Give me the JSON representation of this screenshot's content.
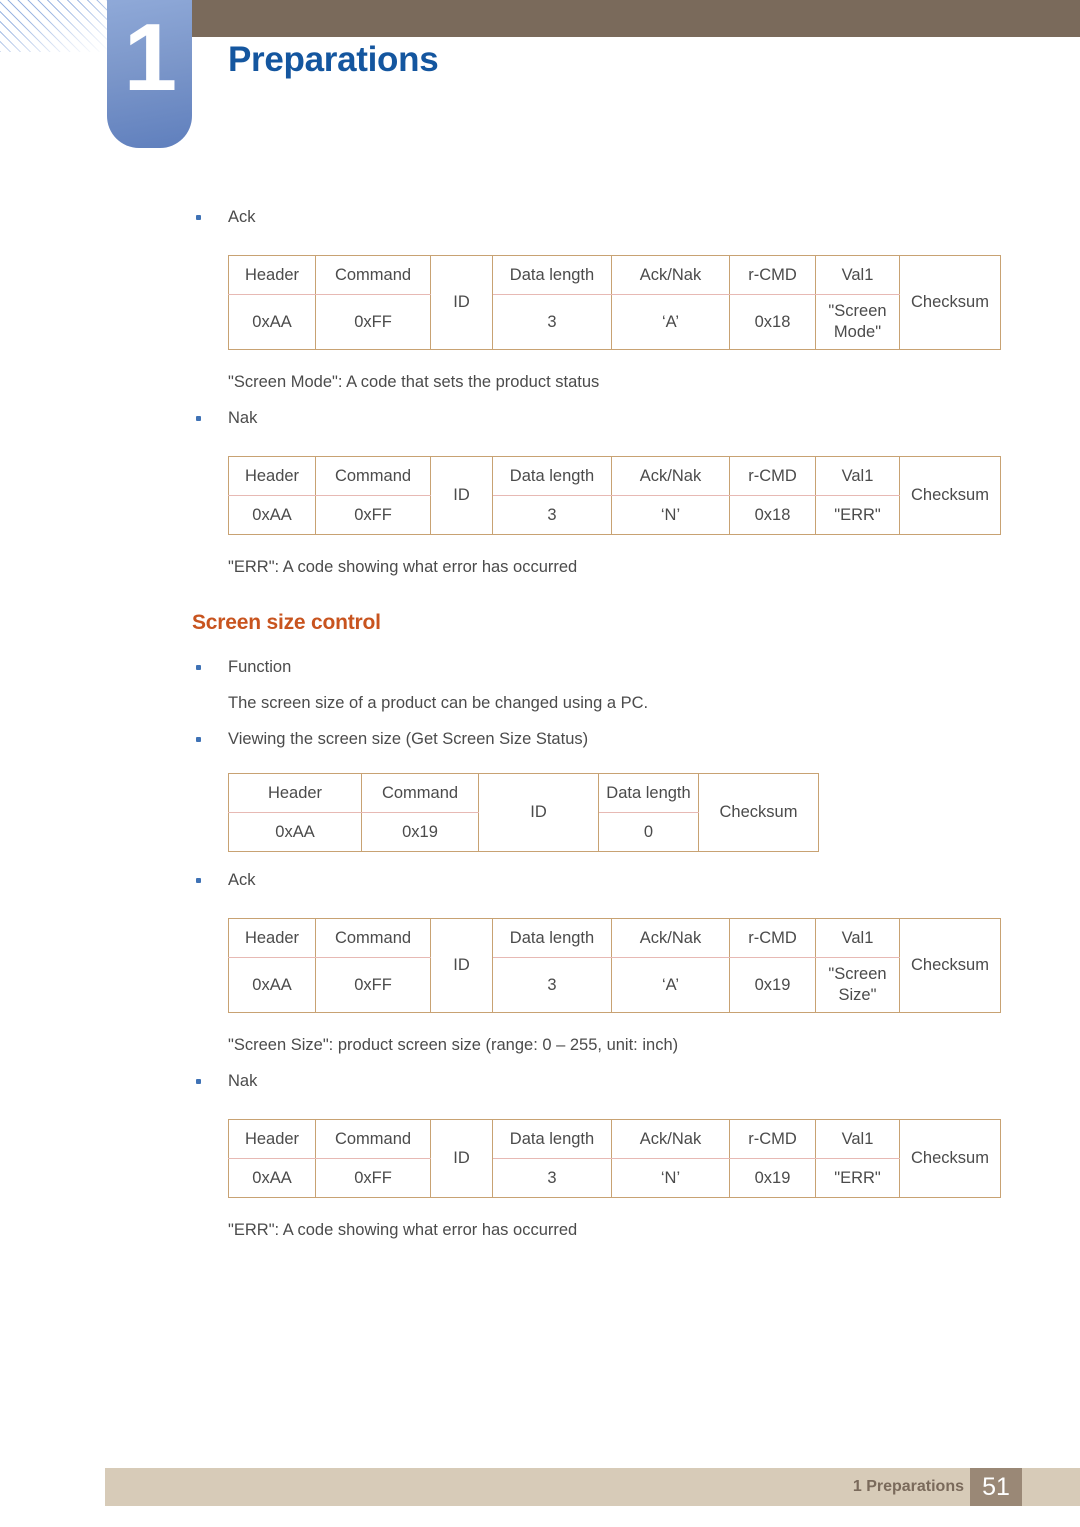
{
  "header": {
    "chapter_number": "1",
    "chapter_title": "Preparations",
    "bar_color": "#7a6a5b",
    "tab_color": "#7c97ca",
    "title_color": "#14569f"
  },
  "footer": {
    "label": "1 Preparations",
    "page_number": "51",
    "bar_color": "#d7cbb8",
    "page_box_color": "#9a8876"
  },
  "section": {
    "heading": "Screen size control",
    "heading_color": "#c8541f"
  },
  "labels": {
    "ack": "Ack",
    "nak": "Nak",
    "function": "Function",
    "viewing": "Viewing the screen size (Get Screen Size Status)"
  },
  "paragraphs": {
    "function_desc": "The screen size of a product can be changed using a PC.",
    "screen_mode_note": "\"Screen Mode\": A code that sets the product status",
    "err_note_1": "\"ERR\": A code showing what error has occurred",
    "screen_size_note": "\"Screen Size\": product screen size (range: 0 – 255, unit: inch)",
    "err_note_2": "\"ERR\": A code showing what error has occurred"
  },
  "tables": {
    "ack_screen_mode": {
      "headers": [
        "Header",
        "Command",
        "ID",
        "Data length",
        "Ack/Nak",
        "r-CMD",
        "Val1",
        "Checksum"
      ],
      "values": [
        "0xAA",
        "0xFF",
        "ID",
        "3",
        "‘A’",
        "0x18",
        "\"Screen Mode\"",
        "Checksum"
      ],
      "val1_line1": "\"Screen",
      "val1_line2": "Mode\""
    },
    "nak_screen_mode": {
      "headers": [
        "Header",
        "Command",
        "ID",
        "Data length",
        "Ack/Nak",
        "r-CMD",
        "Val1",
        "Checksum"
      ],
      "values": [
        "0xAA",
        "0xFF",
        "ID",
        "3",
        "‘N’",
        "0x18",
        "\"ERR\"",
        "Checksum"
      ]
    },
    "get_screen_size": {
      "headers": [
        "Header",
        "Command",
        "ID",
        "Data length",
        "Checksum"
      ],
      "values": [
        "0xAA",
        "0x19",
        "ID",
        "0",
        "Checksum"
      ]
    },
    "ack_screen_size": {
      "headers": [
        "Header",
        "Command",
        "ID",
        "Data length",
        "Ack/Nak",
        "r-CMD",
        "Val1",
        "Checksum"
      ],
      "values": [
        "0xAA",
        "0xFF",
        "ID",
        "3",
        "‘A’",
        "0x19",
        "\"Screen Size\"",
        "Checksum"
      ],
      "val1_line1": "\"Screen",
      "val1_line2": "Size\""
    },
    "nak_screen_size": {
      "headers": [
        "Header",
        "Command",
        "ID",
        "Data length",
        "Ack/Nak",
        "r-CMD",
        "Val1",
        "Checksum"
      ],
      "values": [
        "0xAA",
        "0xFF",
        "ID",
        "3",
        "‘N’",
        "0x19",
        "\"ERR\"",
        "Checksum"
      ]
    }
  }
}
